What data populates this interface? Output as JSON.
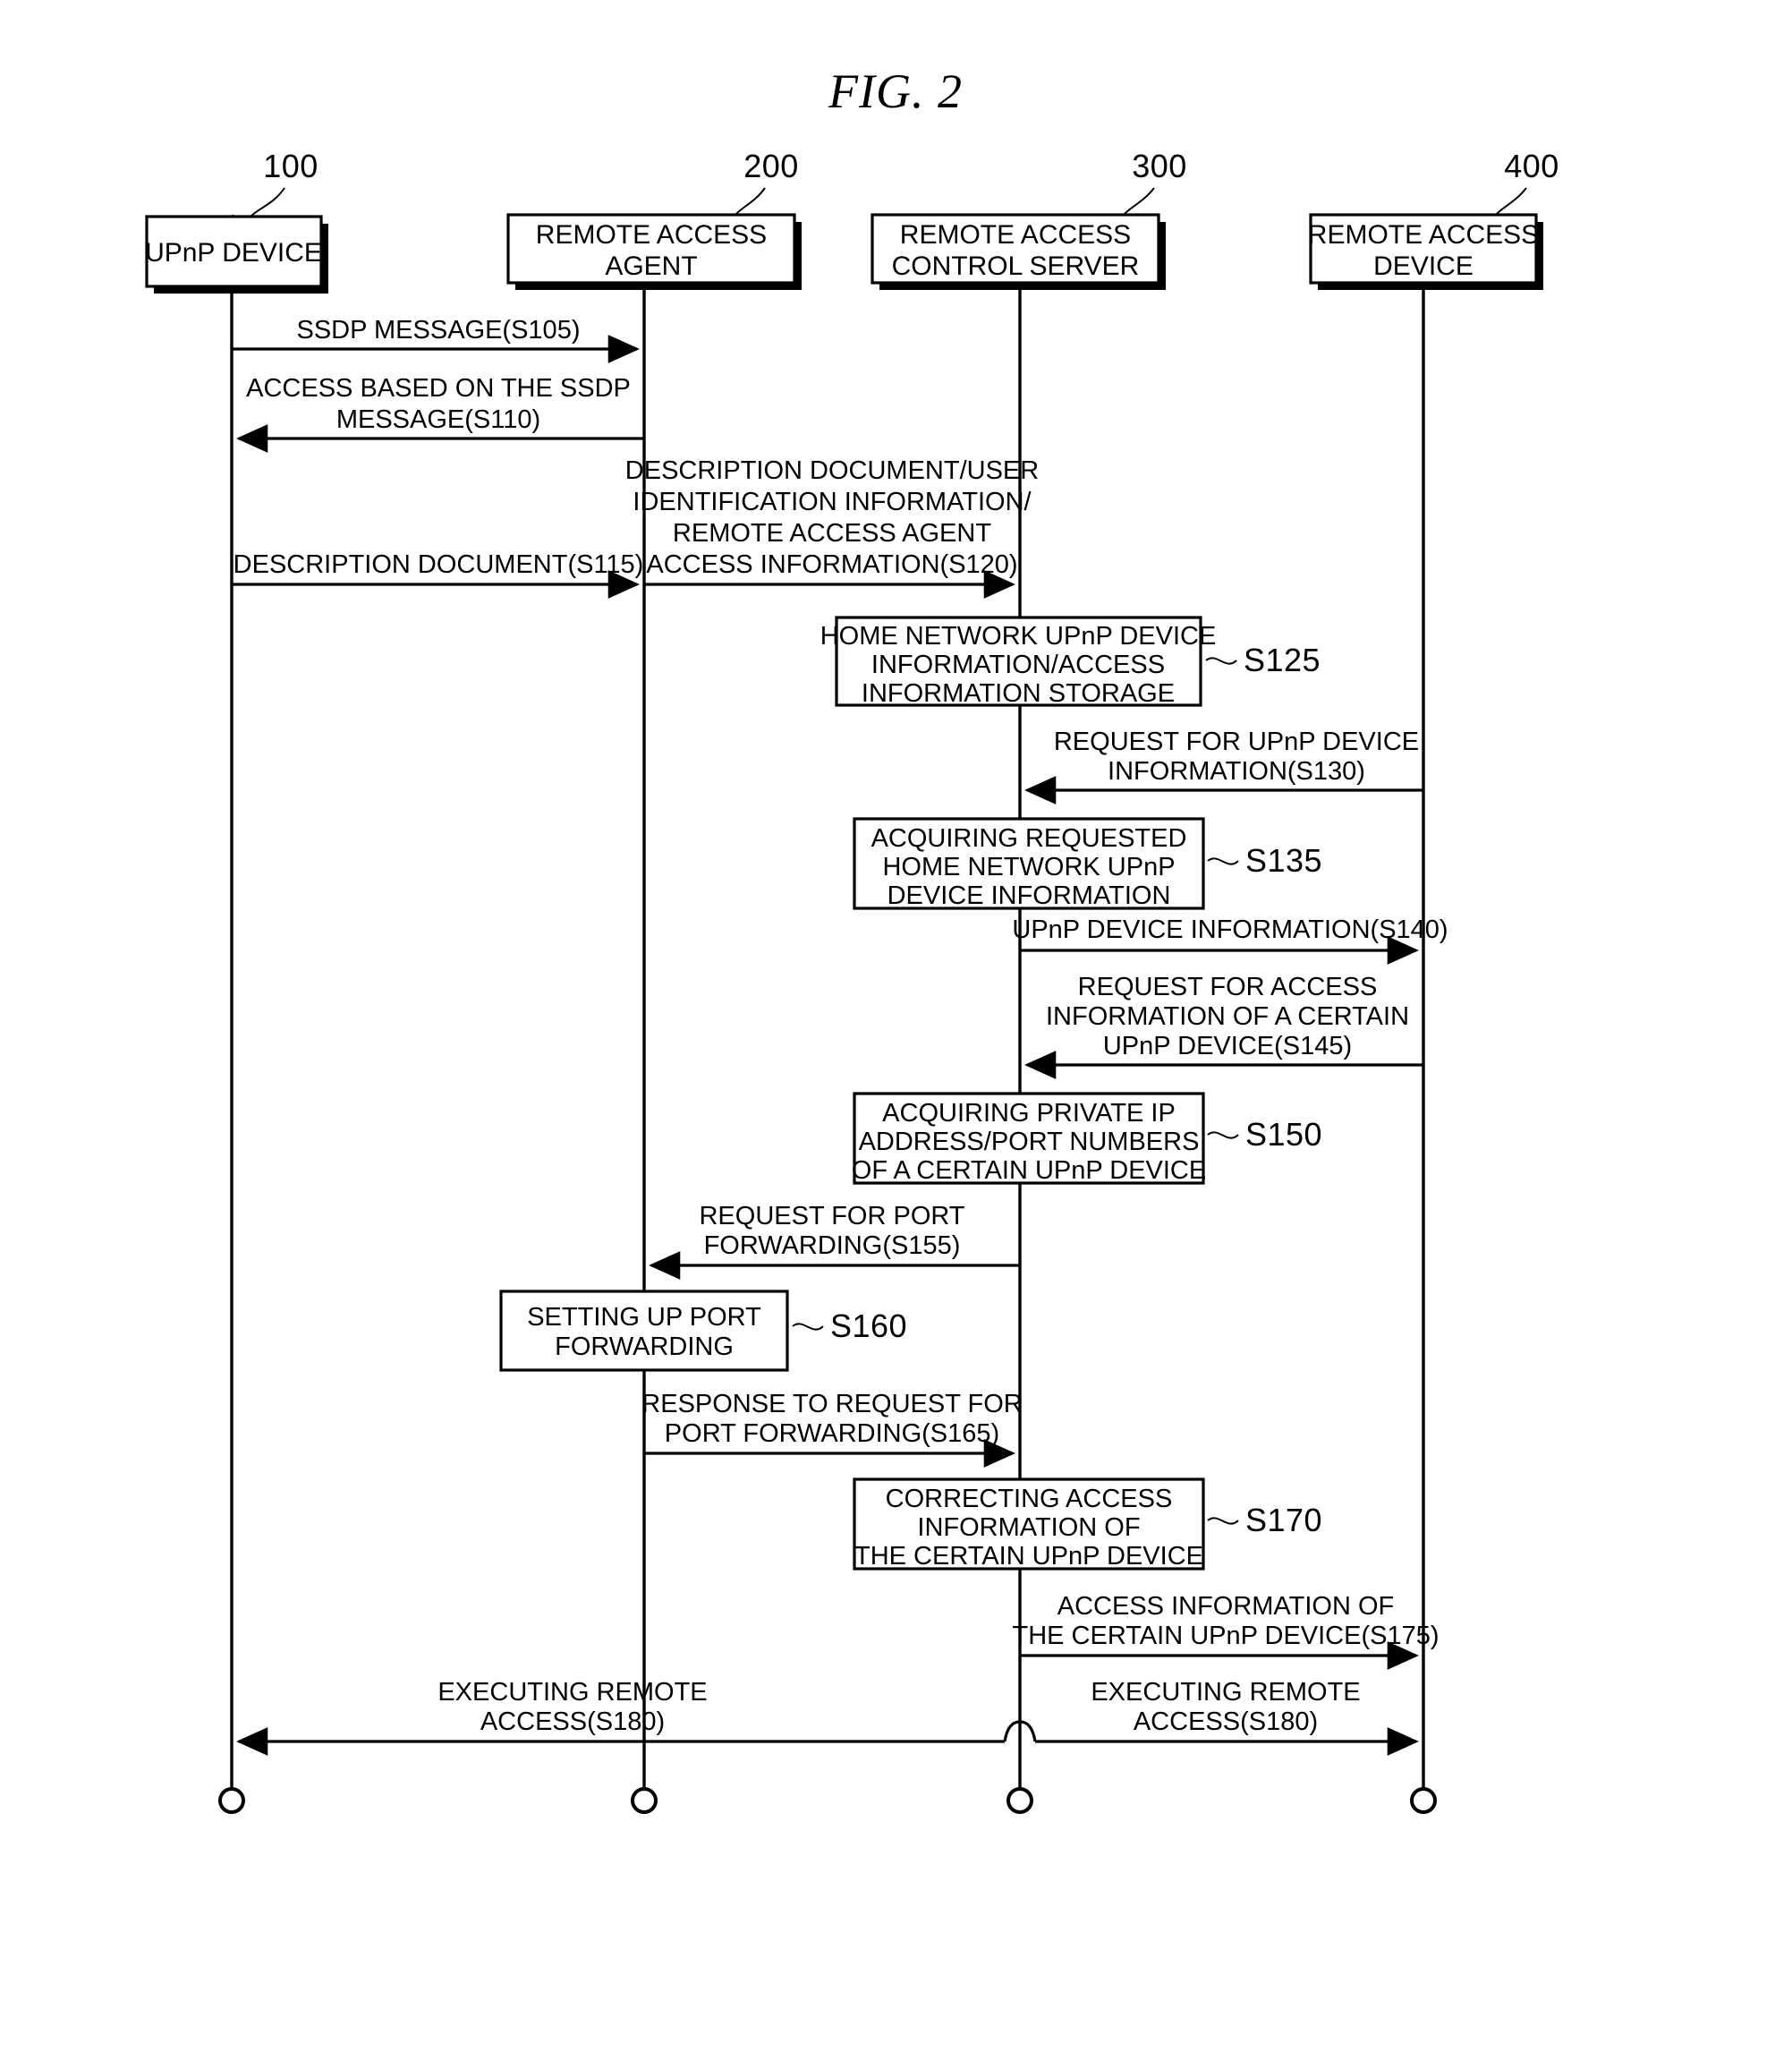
{
  "figure": {
    "title": "FIG. 2",
    "type": "sequence-diagram"
  },
  "lifelines": [
    {
      "ref": "100",
      "label_line1": "UPnP DEVICE",
      "label_line2": ""
    },
    {
      "ref": "200",
      "label_line1": "REMOTE ACCESS",
      "label_line2": "AGENT"
    },
    {
      "ref": "300",
      "label_line1": "REMOTE ACCESS",
      "label_line2": "CONTROL SERVER"
    },
    {
      "ref": "400",
      "label_line1": "REMOTE ACCESS",
      "label_line2": "DEVICE"
    }
  ],
  "messages": [
    {
      "id": "S105",
      "from": "100",
      "to": "200",
      "direction": "right",
      "lines": [
        "SSDP MESSAGE(S105)"
      ]
    },
    {
      "id": "S110",
      "from": "200",
      "to": "100",
      "direction": "left",
      "lines": [
        "ACCESS BASED ON THE SSDP",
        "MESSAGE(S110)"
      ]
    },
    {
      "id": "S115",
      "from": "100",
      "to": "200",
      "direction": "right",
      "lines": [
        "DESCRIPTION DOCUMENT(S115)"
      ]
    },
    {
      "id": "S120",
      "from": "200",
      "to": "300",
      "direction": "right",
      "lines": [
        "DESCRIPTION DOCUMENT/USER",
        "IDENTIFICATION INFORMATION/",
        "REMOTE ACCESS AGENT",
        "ACCESS INFORMATION(S120)"
      ]
    },
    {
      "id": "S130",
      "from": "400",
      "to": "300",
      "direction": "left",
      "lines": [
        "REQUEST FOR UPnP DEVICE",
        "INFORMATION(S130)"
      ]
    },
    {
      "id": "S140",
      "from": "300",
      "to": "400",
      "direction": "right",
      "lines": [
        "UPnP DEVICE INFORMATION(S140)"
      ]
    },
    {
      "id": "S145",
      "from": "400",
      "to": "300",
      "direction": "left",
      "lines": [
        "REQUEST FOR ACCESS",
        "INFORMATION OF A CERTAIN",
        "UPnP DEVICE(S145)"
      ]
    },
    {
      "id": "S155",
      "from": "300",
      "to": "200",
      "direction": "left",
      "lines": [
        "REQUEST FOR PORT",
        "FORWARDING(S155)"
      ]
    },
    {
      "id": "S165",
      "from": "200",
      "to": "300",
      "direction": "right",
      "lines": [
        "RESPONSE TO REQUEST FOR",
        "PORT FORWARDING(S165)"
      ]
    },
    {
      "id": "S175",
      "from": "300",
      "to": "400",
      "direction": "right",
      "lines": [
        "ACCESS INFORMATION OF",
        "THE CERTAIN UPnP DEVICE(S175)"
      ]
    },
    {
      "id": "S180a",
      "from": "300",
      "to": "100",
      "direction": "left",
      "lines": [
        "EXECUTING REMOTE",
        "ACCESS(S180)"
      ]
    },
    {
      "id": "S180b",
      "from": "300",
      "to": "400",
      "direction": "right",
      "lines": [
        "EXECUTING REMOTE",
        "ACCESS(S180)"
      ]
    }
  ],
  "activities": [
    {
      "id": "S125",
      "on": "300",
      "step": "S125",
      "lines": [
        "HOME NETWORK UPnP DEVICE",
        "INFORMATION/ACCESS",
        "INFORMATION STORAGE"
      ]
    },
    {
      "id": "S135",
      "on": "300",
      "step": "S135",
      "lines": [
        "ACQUIRING REQUESTED",
        "HOME NETWORK UPnP",
        "DEVICE INFORMATION"
      ]
    },
    {
      "id": "S150",
      "on": "300",
      "step": "S150",
      "lines": [
        "ACQUIRING PRIVATE IP",
        "ADDRESS/PORT NUMBERS",
        "OF A CERTAIN UPnP DEVICE"
      ]
    },
    {
      "id": "S160",
      "on": "200",
      "step": "S160",
      "lines": [
        "SETTING UP PORT",
        "FORWARDING"
      ]
    },
    {
      "id": "S170",
      "on": "300",
      "step": "S170",
      "lines": [
        "CORRECTING ACCESS",
        "INFORMATION OF",
        "THE CERTAIN UPnP DEVICE"
      ]
    }
  ]
}
